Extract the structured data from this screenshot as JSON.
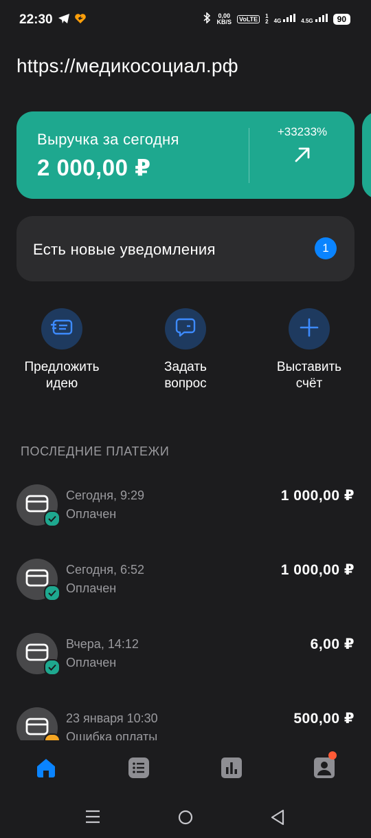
{
  "status_bar": {
    "time": "22:30",
    "net_speed_value": "0,00",
    "net_speed_unit": "KB/S",
    "volte": "VoLTE",
    "sim_slots": "1\n2",
    "net_4g": "4G",
    "net_45g": "4.5G",
    "battery": "90"
  },
  "url": "https://медикосоциал.рф",
  "revenue": {
    "title": "Выручка за сегодня",
    "amount": "2 000,00 ₽",
    "change": "+33233%",
    "arrow_icon": "arrow-up-right-icon"
  },
  "notifications": {
    "text": "Есть новые уведомления",
    "count": "1"
  },
  "actions": [
    {
      "label": "Предложить\nидею",
      "icon": "idea-card-icon"
    },
    {
      "label": "Задать\nвопрос",
      "icon": "chat-bubble-icon"
    },
    {
      "label": "Выставить\nсчёт",
      "icon": "plus-icon"
    }
  ],
  "payments_section_title": "ПОСЛЕДНИЕ ПЛАТЕЖИ",
  "payments": [
    {
      "date": "Сегодня, 9:29",
      "status": "Оплачен",
      "amount": "1 000,00 ₽",
      "state": "ok"
    },
    {
      "date": "Сегодня, 6:52",
      "status": "Оплачен",
      "amount": "1 000,00 ₽",
      "state": "ok"
    },
    {
      "date": "Вчера, 14:12",
      "status": "Оплачен",
      "amount": "6,00 ₽",
      "state": "ok"
    },
    {
      "date": "23 января 10:30",
      "status": "Ошибка оплаты",
      "amount": "500,00 ₽",
      "state": "error"
    }
  ],
  "bottom_nav": [
    {
      "icon": "home-icon",
      "active": true
    },
    {
      "icon": "list-icon",
      "active": false
    },
    {
      "icon": "chart-icon",
      "active": false
    },
    {
      "icon": "profile-icon",
      "active": false,
      "badge": true
    }
  ],
  "colors": {
    "background": "#1c1c1e",
    "accent_green": "#1ea88f",
    "accent_blue": "#0a84ff",
    "card": "#2c2c2e",
    "muted_text": "#9a9a9e",
    "badge_orange": "#ff5a36"
  }
}
